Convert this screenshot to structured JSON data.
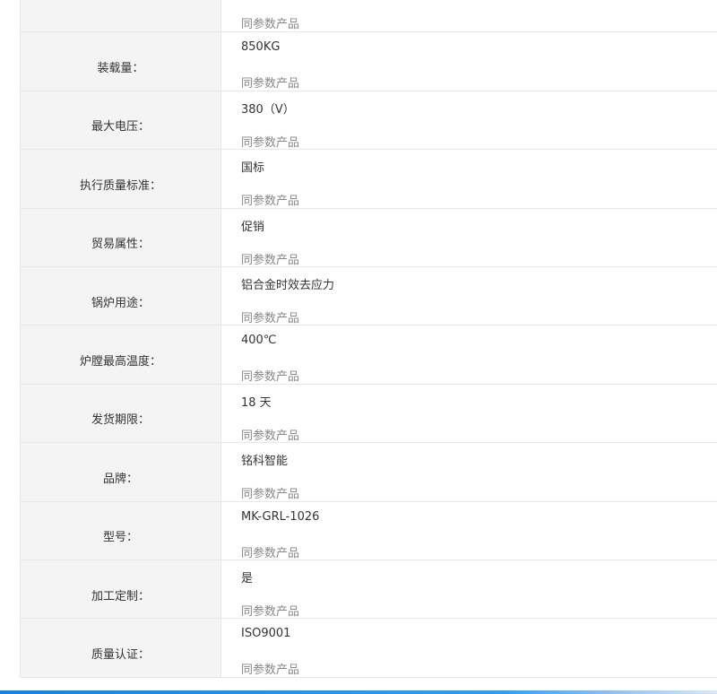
{
  "spec_rows": [
    {
      "label": "",
      "value": "",
      "same_link": "同参数产品"
    },
    {
      "label": "装载量：",
      "value": "850KG",
      "same_link": "同参数产品"
    },
    {
      "label": "最大电压：",
      "value": "380（V）",
      "same_link": "同参数产品"
    },
    {
      "label": "执行质量标准：",
      "value": "国标",
      "same_link": "同参数产品"
    },
    {
      "label": "贸易属性：",
      "value": "促销",
      "same_link": "同参数产品"
    },
    {
      "label": "锅炉用途：",
      "value": "铝合金时效去应力",
      "same_link": "同参数产品"
    },
    {
      "label": "炉膛最高温度：",
      "value": "400℃",
      "same_link": "同参数产品"
    },
    {
      "label": "发货期限：",
      "value": "18 天",
      "same_link": "同参数产品"
    },
    {
      "label": "品牌：",
      "value": "铭科智能",
      "same_link": "同参数产品"
    },
    {
      "label": "型号：",
      "value": "MK-GRL-1026",
      "same_link": "同参数产品"
    },
    {
      "label": "加工定制：",
      "value": "是",
      "same_link": "同参数产品"
    },
    {
      "label": "质量认证：",
      "value": "ISO9001",
      "same_link": "同参数产品"
    }
  ],
  "colors": {
    "label_bg": "#f4f4f4",
    "border": "#e6e6e6",
    "link_gray": "#888888",
    "accent_bar": "#1e7fd6"
  }
}
